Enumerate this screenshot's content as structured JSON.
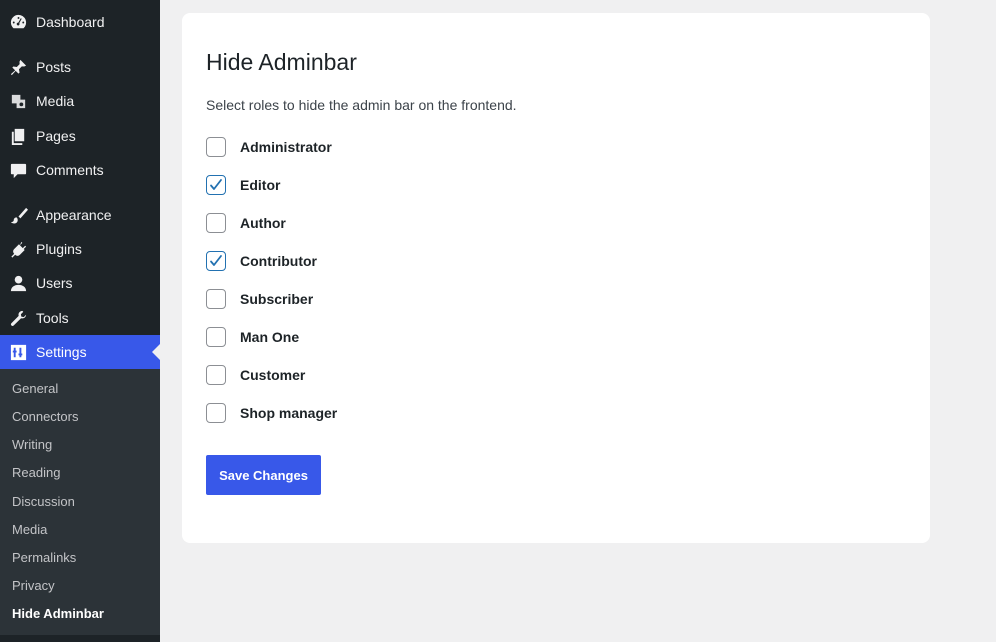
{
  "sidebar": {
    "items": [
      {
        "label": "Dashboard",
        "icon": "dashboard-icon"
      },
      {
        "label": "Posts",
        "icon": "pushpin-icon"
      },
      {
        "label": "Media",
        "icon": "media-icon"
      },
      {
        "label": "Pages",
        "icon": "pages-icon"
      },
      {
        "label": "Comments",
        "icon": "comment-icon"
      },
      {
        "label": "Appearance",
        "icon": "paintbrush-icon"
      },
      {
        "label": "Plugins",
        "icon": "plugin-icon"
      },
      {
        "label": "Users",
        "icon": "user-icon"
      },
      {
        "label": "Tools",
        "icon": "wrench-icon"
      },
      {
        "label": "Settings",
        "icon": "settings-sliders-icon"
      }
    ],
    "submenu": [
      "General",
      "Connectors",
      "Writing",
      "Reading",
      "Discussion",
      "Media",
      "Permalinks",
      "Privacy",
      "Hide Adminbar"
    ]
  },
  "page": {
    "title": "Hide Adminbar",
    "description": "Select roles to hide the admin bar on the frontend.",
    "roles": [
      {
        "label": "Administrator",
        "checked": false
      },
      {
        "label": "Editor",
        "checked": true
      },
      {
        "label": "Author",
        "checked": false
      },
      {
        "label": "Contributor",
        "checked": true
      },
      {
        "label": "Subscriber",
        "checked": false
      },
      {
        "label": "Man One",
        "checked": false
      },
      {
        "label": "Customer",
        "checked": false
      },
      {
        "label": "Shop manager",
        "checked": false
      }
    ],
    "save_label": "Save Changes"
  },
  "colors": {
    "sidebar_bg": "#1d2327",
    "accent": "#3858e9",
    "checkbox_checked": "#2271b1",
    "page_bg": "#f0f0f1"
  }
}
